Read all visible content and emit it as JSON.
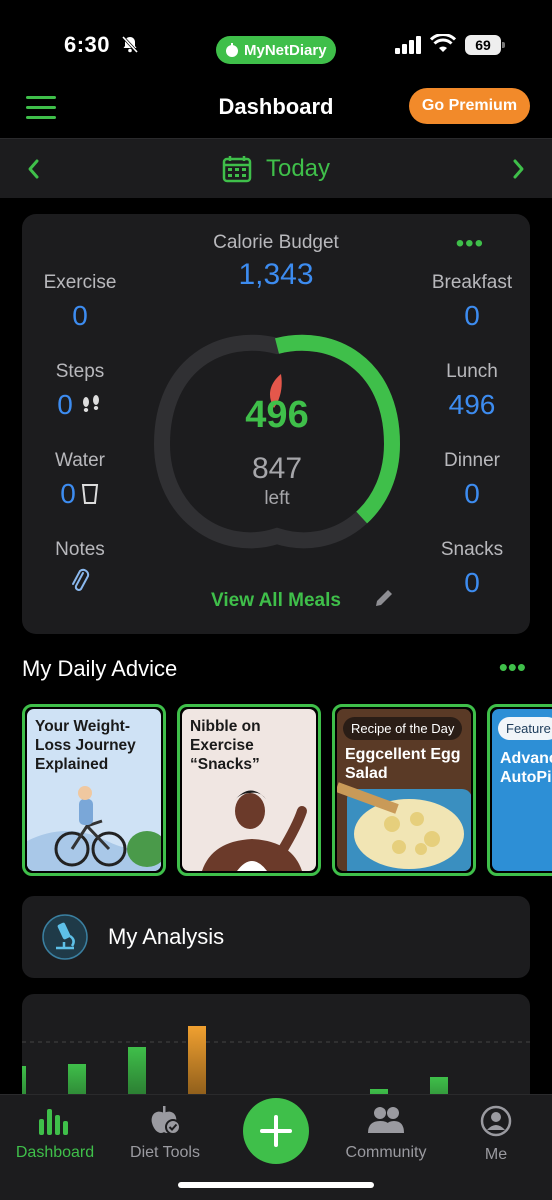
{
  "status_bar": {
    "time": "6:30",
    "battery": "69",
    "brand_my": "MyNet",
    "brand_diary": "Diary"
  },
  "header": {
    "title": "Dashboard",
    "premium_label": "Go Premium"
  },
  "date_nav": {
    "label": "Today"
  },
  "calorie_card": {
    "budget_label": "Calorie Budget",
    "budget_value": "1,343",
    "eaten": "496",
    "left_value": "847",
    "left_label": "left",
    "progress_fraction": 0.37,
    "view_all": "View All Meals",
    "left_stats": [
      {
        "label": "Exercise",
        "value": "0"
      },
      {
        "label": "Steps",
        "value": "0"
      },
      {
        "label": "Water",
        "value": "0"
      },
      {
        "label": "Notes",
        "value": ""
      }
    ],
    "right_stats": [
      {
        "label": "Breakfast",
        "value": "0"
      },
      {
        "label": "Lunch",
        "value": "496"
      },
      {
        "label": "Dinner",
        "value": "0"
      },
      {
        "label": "Snacks",
        "value": "0"
      }
    ]
  },
  "advice": {
    "title": "My Daily Advice",
    "tiles": [
      {
        "text": "Your Weight-Loss Journey Explained",
        "badge": ""
      },
      {
        "text": "Nibble on Exercise “Snacks”",
        "badge": ""
      },
      {
        "text": "Eggcellent Egg Salad",
        "badge": "Recipe of the Day"
      },
      {
        "text": "Advanced AutoPilot",
        "badge": "Feature"
      }
    ]
  },
  "analysis": {
    "label": "My Analysis"
  },
  "tabs": [
    {
      "label": "Dashboard"
    },
    {
      "label": "Diet Tools"
    },
    {
      "label": "Community"
    },
    {
      "label": "Me"
    }
  ],
  "colors": {
    "accent_green": "#3fbf4a",
    "value_blue": "#3d8cf0",
    "premium_orange": "#f28a2a",
    "card_bg": "#1c1c1e"
  }
}
